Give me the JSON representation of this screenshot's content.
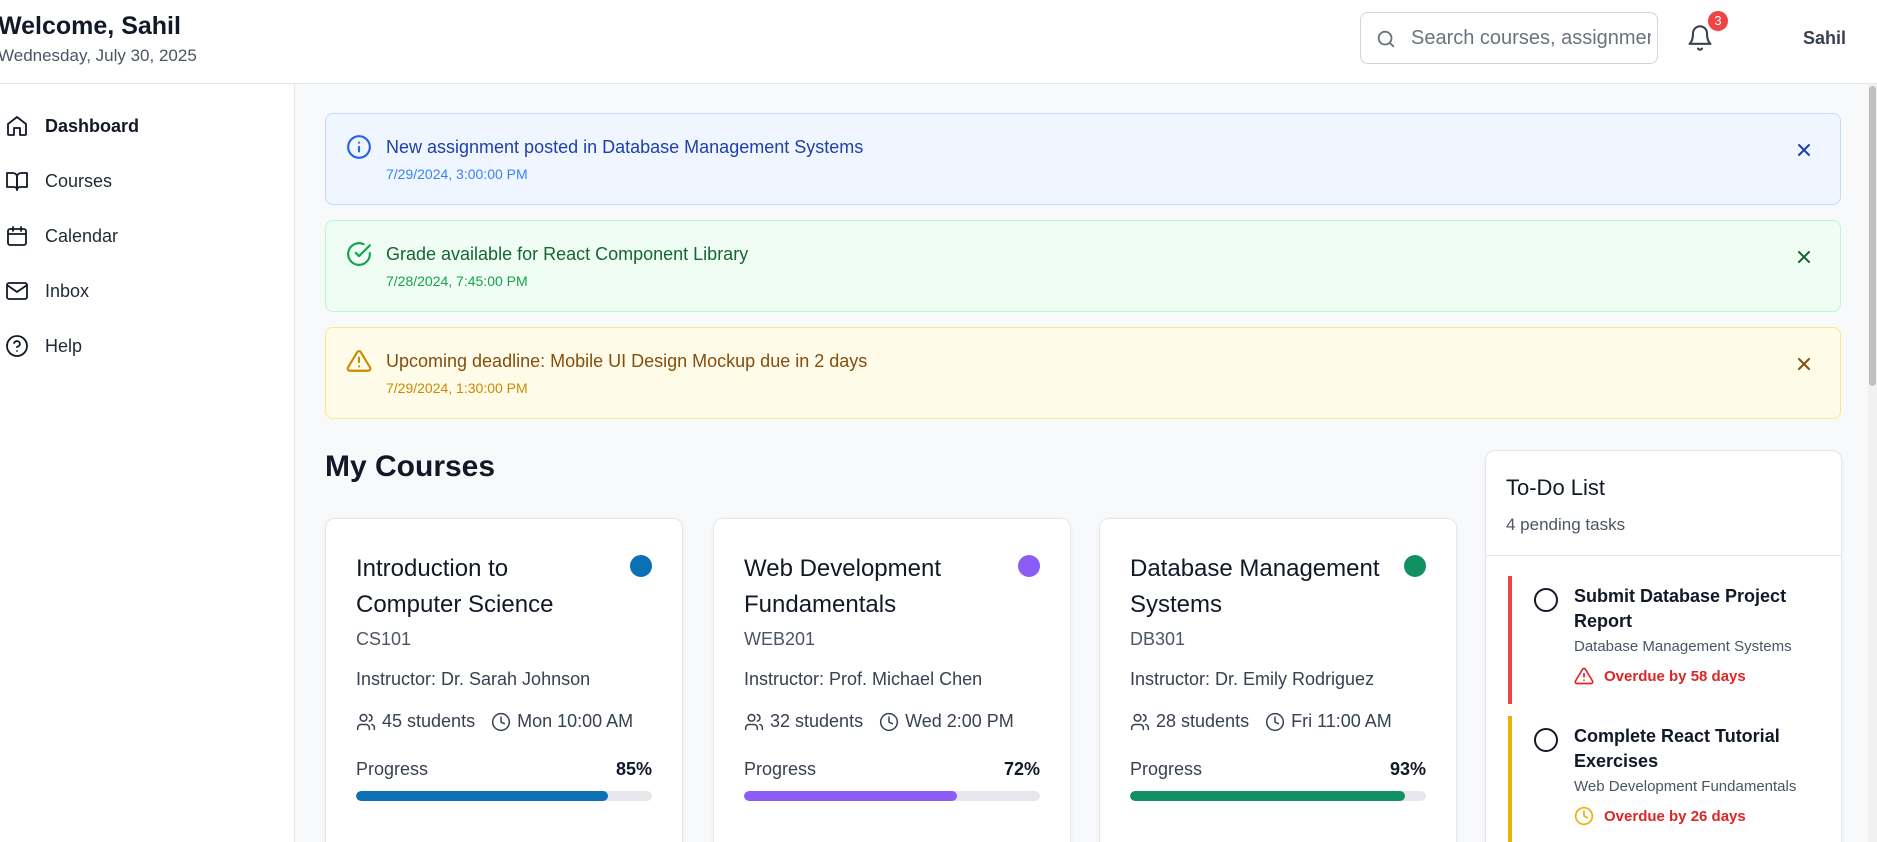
{
  "header": {
    "welcome": "Welcome, Sahil",
    "date": "Wednesday, July 30, 2025",
    "search_placeholder": "Search courses, assignments...",
    "notification_count": "3",
    "user_name": "Sahil"
  },
  "sidebar": {
    "items": [
      {
        "label": "Dashboard",
        "icon": "home-icon",
        "active": true
      },
      {
        "label": "Courses",
        "icon": "book-open-icon"
      },
      {
        "label": "Calendar",
        "icon": "calendar-icon"
      },
      {
        "label": "Inbox",
        "icon": "mail-icon"
      },
      {
        "label": "Help",
        "icon": "help-circle-icon"
      }
    ]
  },
  "notifications": [
    {
      "type": "info",
      "title": "New assignment posted in Database Management Systems",
      "time": "7/29/2024, 3:00:00 PM"
    },
    {
      "type": "success",
      "title": "Grade available for React Component Library",
      "time": "7/28/2024, 7:45:00 PM"
    },
    {
      "type": "warning",
      "title": "Upcoming deadline: Mobile UI Design Mockup due in 2 days",
      "time": "7/29/2024, 1:30:00 PM"
    }
  ],
  "courses_section": {
    "title": "My Courses",
    "progress_label": "Progress",
    "courses": [
      {
        "title": "Introduction to Computer Science",
        "code": "CS101",
        "instructor": "Instructor: Dr. Sarah Johnson",
        "students": "45 students",
        "schedule": "Mon 10:00 AM",
        "progress": 85,
        "progress_text": "85%",
        "color": "#0c70b4"
      },
      {
        "title": "Web Development Fundamentals",
        "code": "WEB201",
        "instructor": "Instructor: Prof. Michael Chen",
        "students": "32 students",
        "schedule": "Wed 2:00 PM",
        "progress": 72,
        "progress_text": "72%",
        "color": "#8b5cf6"
      },
      {
        "title": "Database Management Systems",
        "code": "DB301",
        "instructor": "Instructor: Dr. Emily Rodriguez",
        "students": "28 students",
        "schedule": "Fri 11:00 AM",
        "progress": 93,
        "progress_text": "93%",
        "color": "#109164"
      }
    ]
  },
  "todo": {
    "title": "To-Do List",
    "subtitle": "4 pending tasks",
    "tasks": [
      {
        "title": "Submit Database Project Report",
        "course": "Database Management Systems",
        "due": "Overdue by 58 days",
        "accent": "#ef4444",
        "icon": "alert-triangle-icon"
      },
      {
        "title": "Complete React Tutorial Exercises",
        "course": "Web Development Fundamentals",
        "due": "Overdue by 26 days",
        "accent": "#eab308",
        "icon": "clock-icon"
      }
    ]
  },
  "colors": {
    "info": "#1d4ed8",
    "success": "#16a34a",
    "warning": "#ca8a04",
    "danger": "#dc2626"
  }
}
